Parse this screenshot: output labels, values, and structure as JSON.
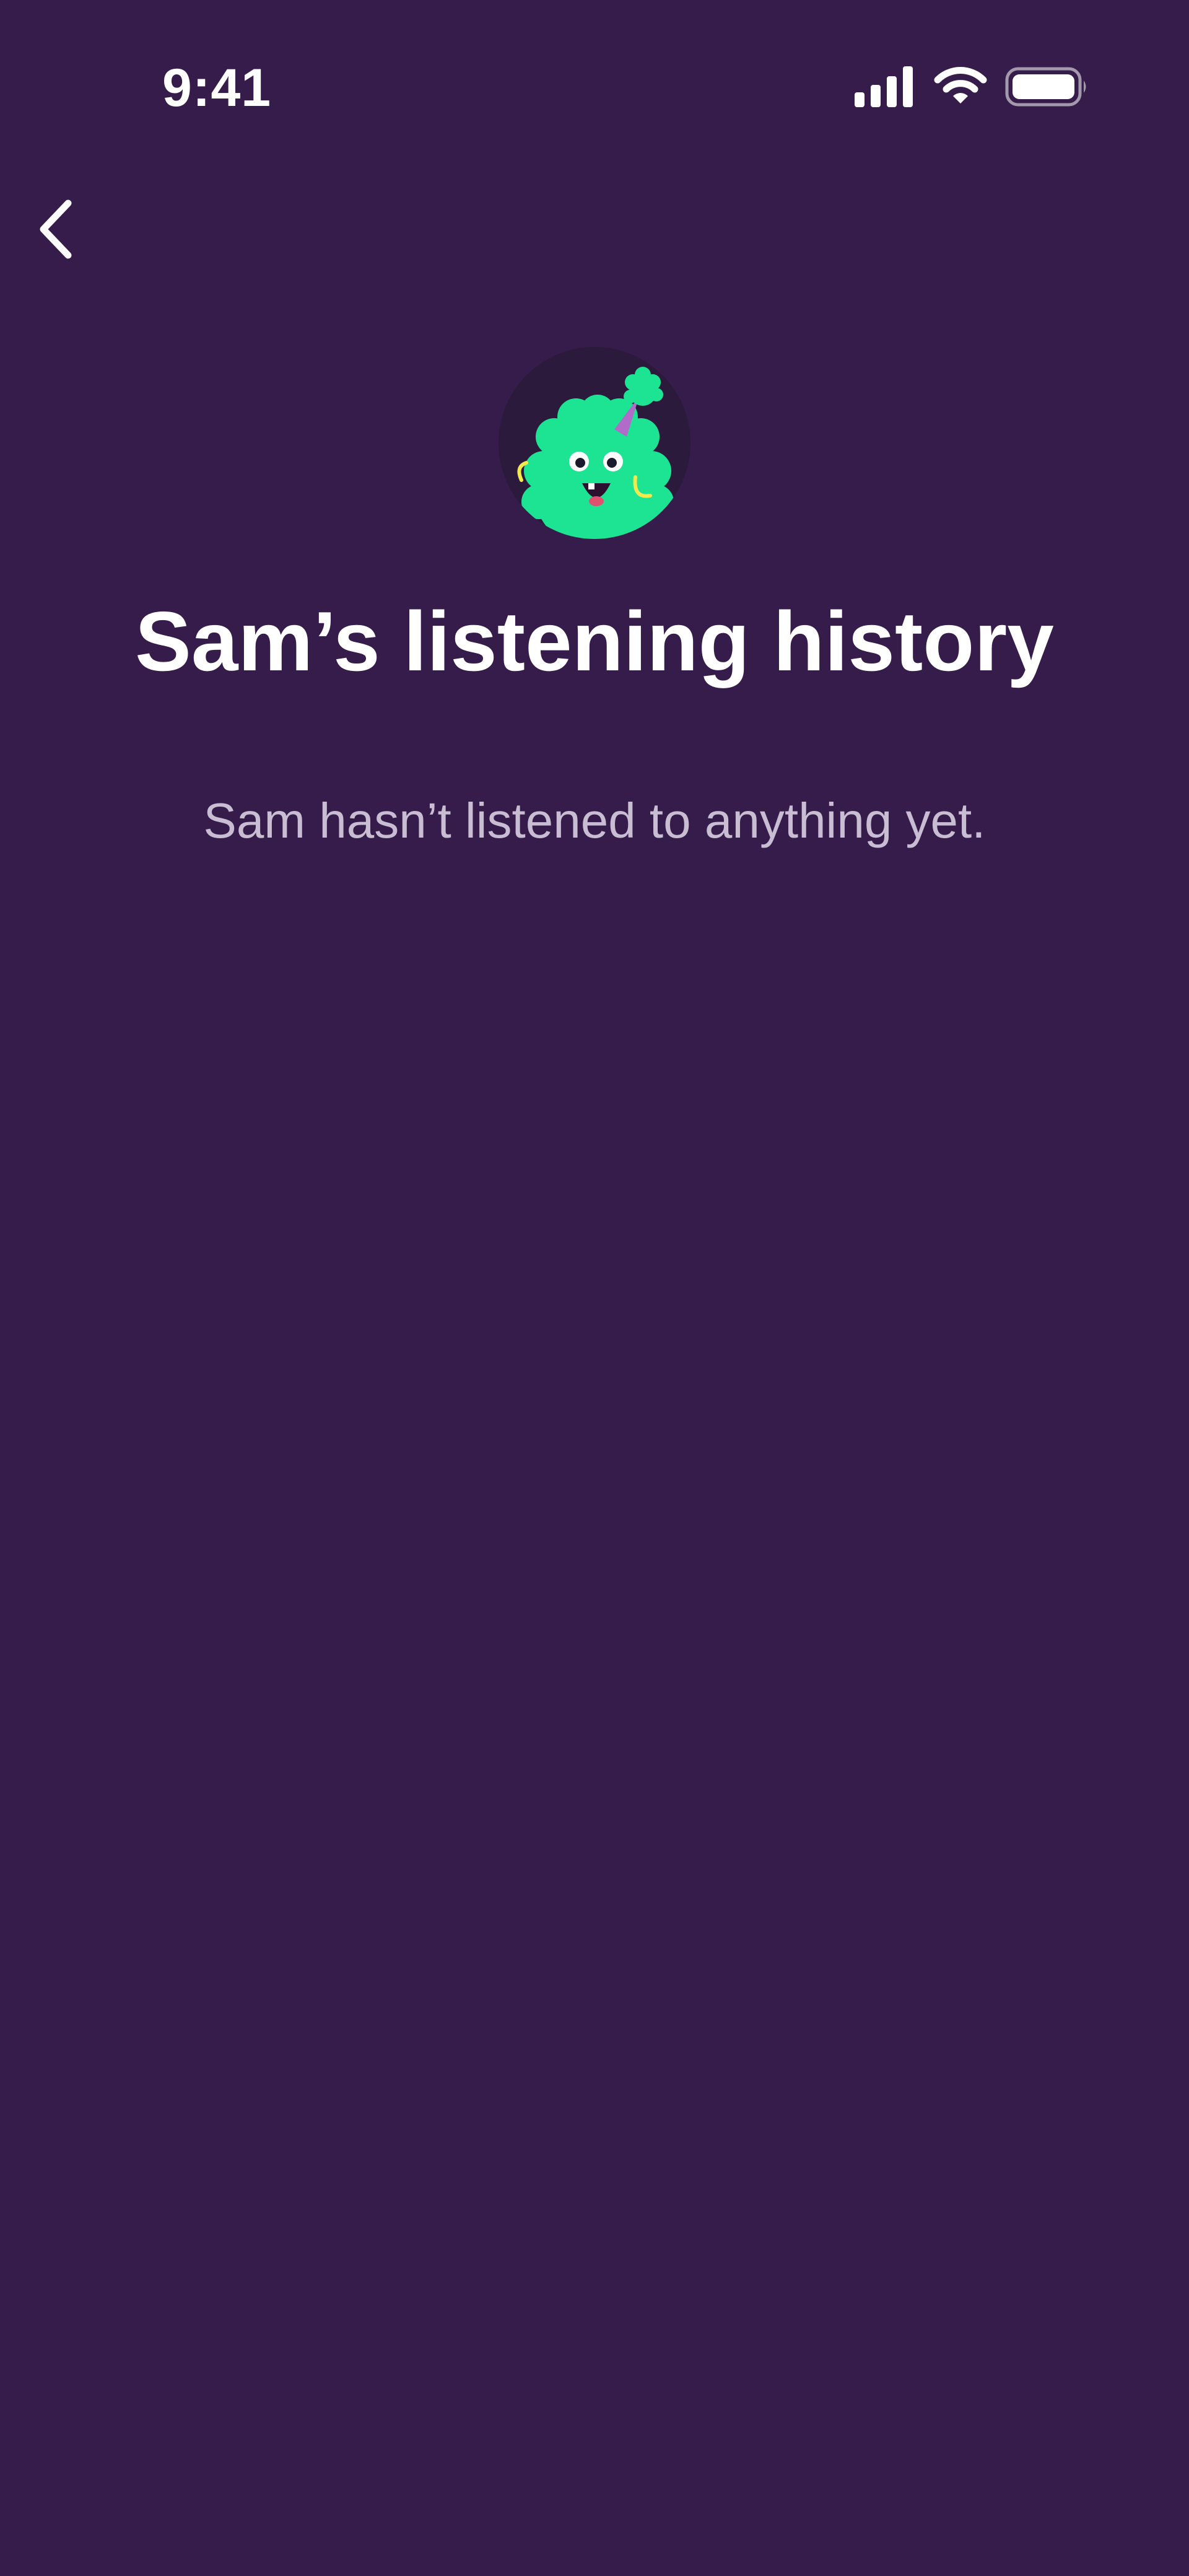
{
  "status_bar": {
    "time": "9:41",
    "icons": [
      "cellular-signal-icon",
      "wifi-icon",
      "battery-icon"
    ]
  },
  "navigation": {
    "back_icon": "chevron-left-icon"
  },
  "profile": {
    "avatar_icon": "green-monster-avatar-icon",
    "title": "Sam’s listening history",
    "empty_message": "Sam hasn’t listened to anything yet."
  },
  "colors": {
    "background": "#351C4A",
    "title_text": "#FFFFFF",
    "secondary_text": "#C9BDD3",
    "avatar_green": "#1DE493",
    "avatar_circle": "#2C1A3D",
    "party_hat": "#B06CC8"
  }
}
